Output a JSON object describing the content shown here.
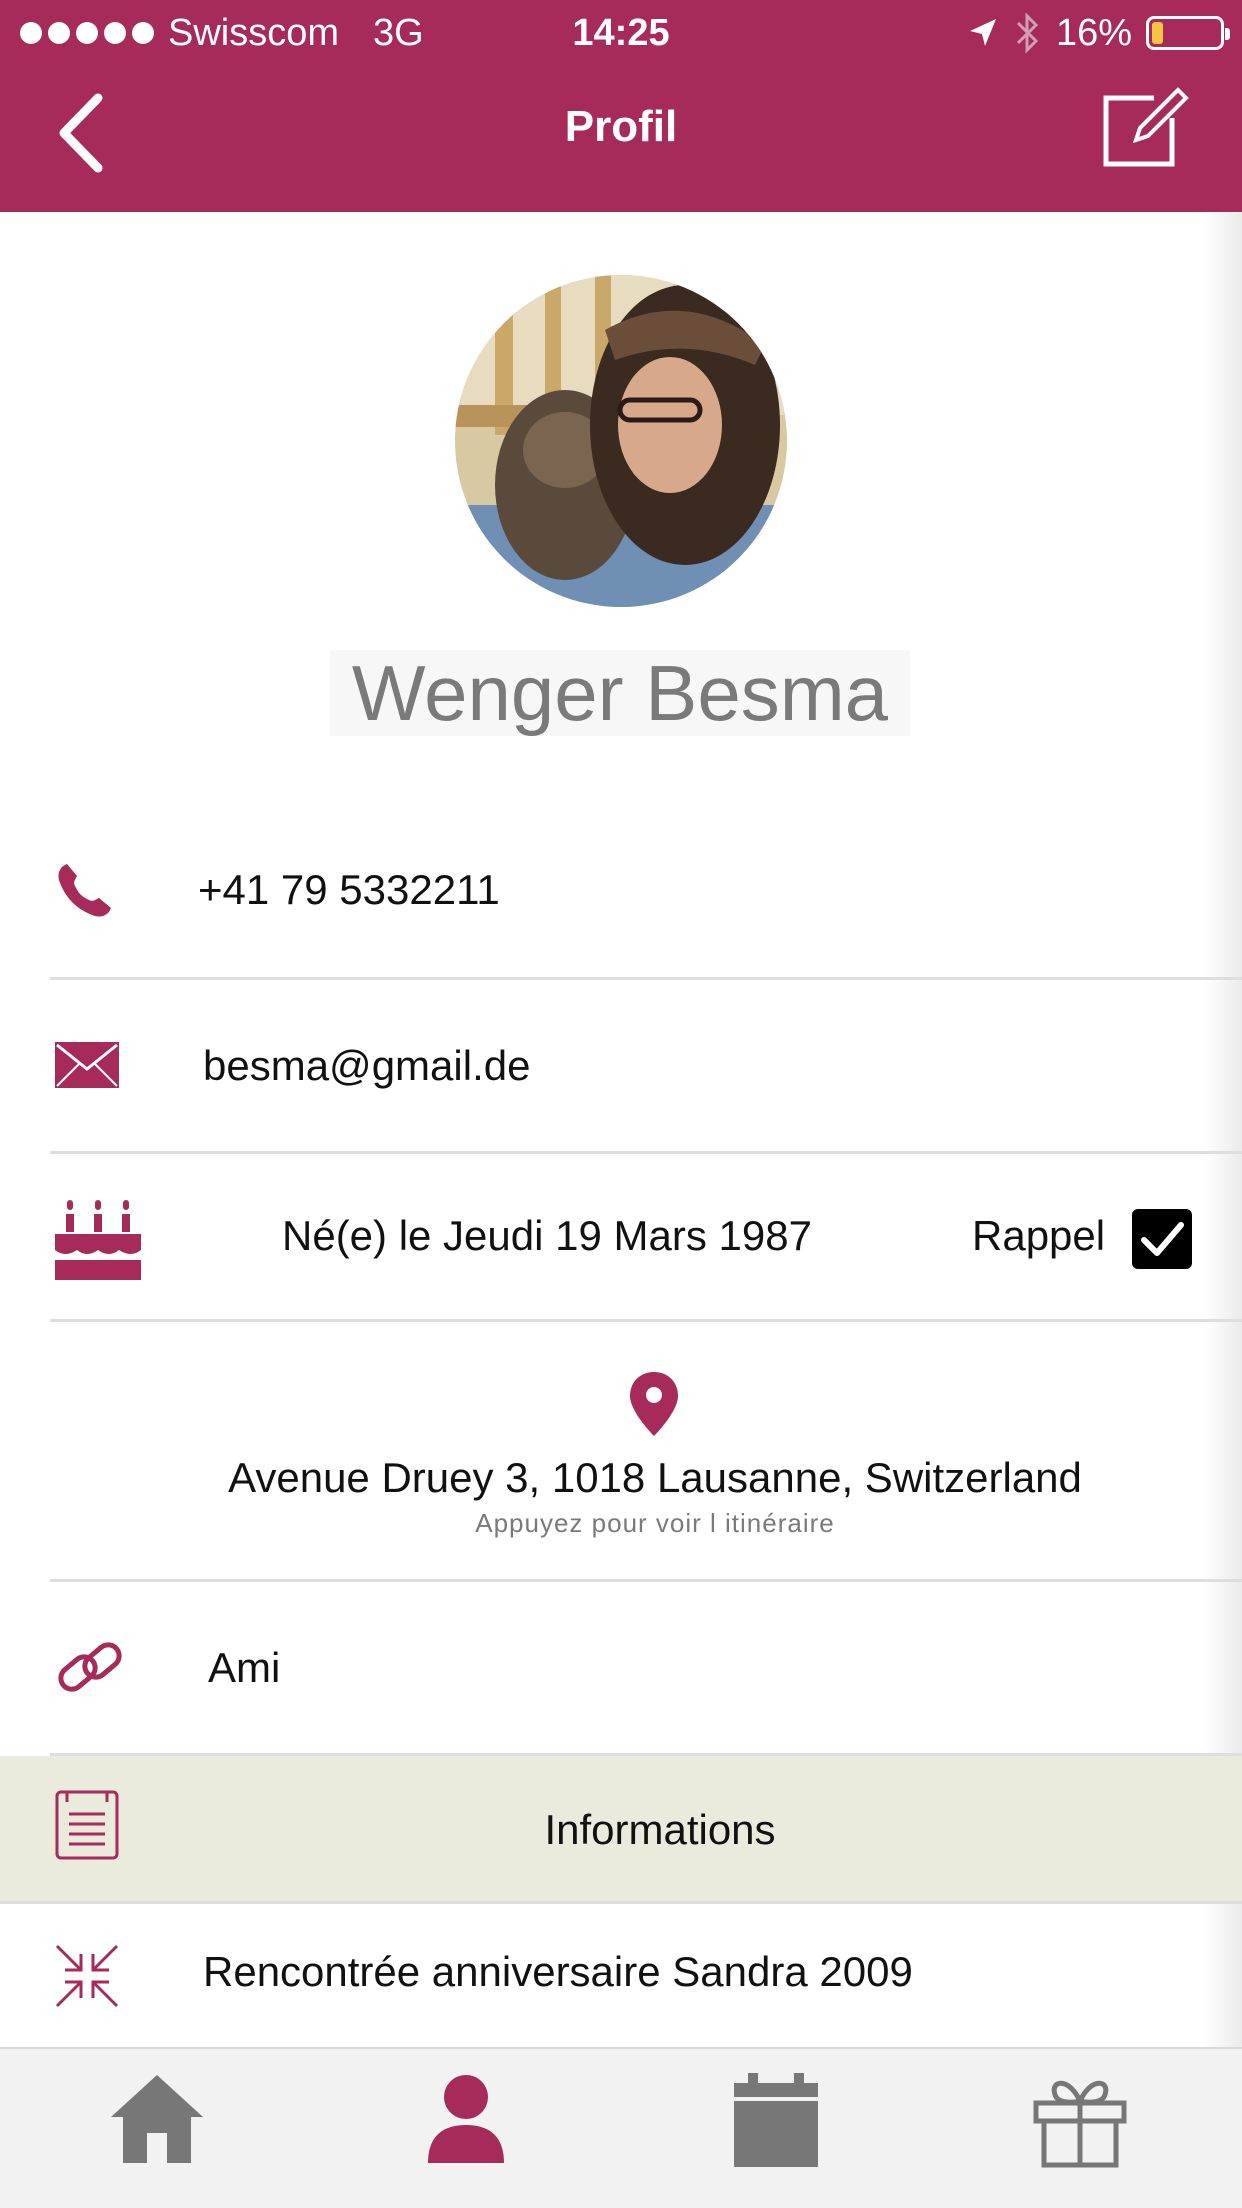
{
  "status_bar": {
    "carrier": "Swisscom",
    "network": "3G",
    "time": "14:25",
    "battery": "16%",
    "battery_level": 0.16
  },
  "nav": {
    "title": "Profil",
    "back_icon": "chevron-left-icon",
    "edit_icon": "edit-icon"
  },
  "profile": {
    "name": "Wenger Besma",
    "phone": "+41 79 5332211",
    "email": "besma@gmail.de",
    "birthday": "Né(e) le Jeudi 19 Mars 1987",
    "reminder_label": "Rappel",
    "reminder_checked": true,
    "address": "Avenue Druey 3, 1018 Lausanne, Switzerland",
    "address_hint": "Appuyez pour voir l itinéraire",
    "relation": "Ami",
    "info_section_title": "Informations",
    "note": "Rencontrée anniversaire Sandra 2009"
  },
  "tabs": [
    {
      "icon": "home-icon",
      "active": false
    },
    {
      "icon": "user-icon",
      "active": true
    },
    {
      "icon": "calendar-icon",
      "active": false
    },
    {
      "icon": "gift-icon",
      "active": false
    }
  ],
  "colors": {
    "accent": "#a62a5a",
    "info_band": "#ebebdd",
    "tab_inactive": "#777777"
  }
}
